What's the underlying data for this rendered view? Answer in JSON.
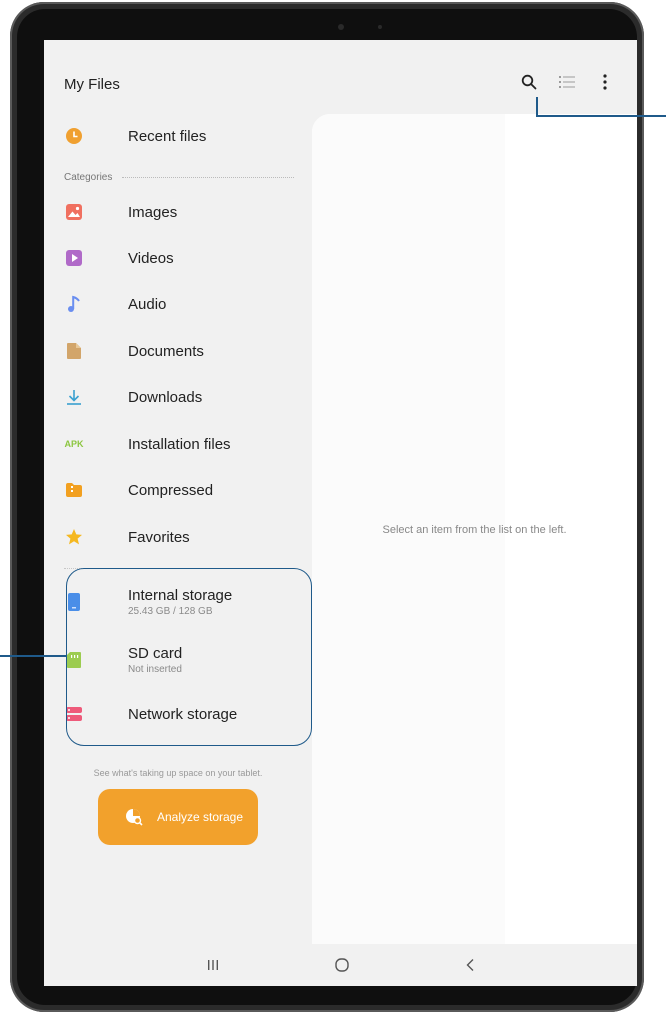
{
  "app": {
    "title": "My Files"
  },
  "toolbar": {
    "search_icon": "search-icon",
    "view_icon": "list-view-icon",
    "more_icon": "more-options-icon"
  },
  "sidebar": {
    "recent": {
      "label": "Recent files",
      "icon": "clock-icon",
      "color": "#f0a030"
    },
    "categories_heading": "Categories",
    "categories": [
      {
        "label": "Images",
        "icon": "image-icon",
        "color": "#f07060"
      },
      {
        "label": "Videos",
        "icon": "video-icon",
        "color": "#b06ac8"
      },
      {
        "label": "Audio",
        "icon": "music-note-icon",
        "color": "#6a8ef0"
      },
      {
        "label": "Documents",
        "icon": "document-icon",
        "color": "#d2a56a"
      },
      {
        "label": "Downloads",
        "icon": "download-icon",
        "color": "#3aa0d0"
      },
      {
        "label": "Installation files",
        "icon": "apk-icon",
        "icon_text": "APK",
        "color": "#8cc640"
      },
      {
        "label": "Compressed",
        "icon": "zip-folder-icon",
        "color": "#f2a020"
      },
      {
        "label": "Favorites",
        "icon": "star-icon",
        "color": "#f5b820"
      }
    ],
    "storage": [
      {
        "label": "Internal storage",
        "sub": "25.43 GB / 128 GB",
        "icon": "phone-storage-icon",
        "color": "#4a8ee8"
      },
      {
        "label": "SD card",
        "sub": "Not inserted",
        "icon": "sd-card-icon",
        "color": "#9ccc50"
      },
      {
        "label": "Network storage",
        "icon": "server-icon",
        "color": "#ee5a7a"
      }
    ],
    "hint": "See what's taking up space on your tablet.",
    "analyze_label": "Analyze storage"
  },
  "content": {
    "empty_message": "Select an item from the list on the left."
  },
  "navbar": {
    "recents": "recent-apps-icon",
    "home": "home-icon",
    "back": "back-icon"
  }
}
